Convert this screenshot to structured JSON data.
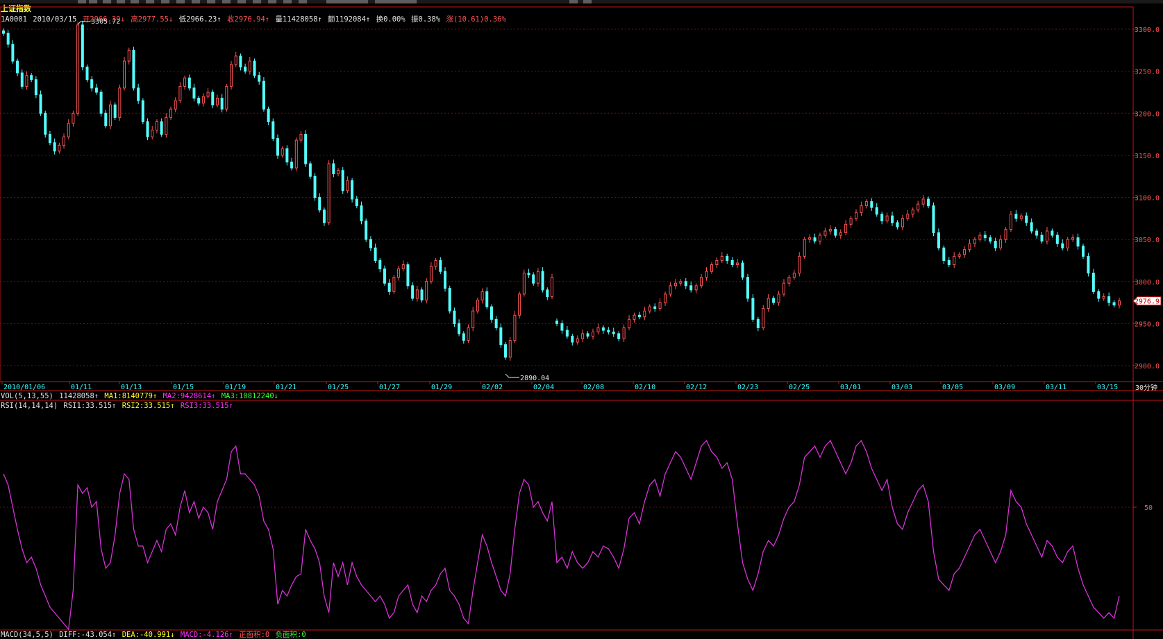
{
  "colors": {
    "background": "#000000",
    "frame": "#c81414",
    "grid": "#6e0f0f",
    "up_candle": "#ff5555",
    "down_candle": "#54ffff",
    "rsi_line": "#d633d6",
    "price_axis_text": "#ff5555",
    "date_axis_text": "#33ffff"
  },
  "header": {
    "index_name": "上证指数",
    "code": "1A0001",
    "date": "2010/03/15",
    "open_label": "开2966.39↓",
    "high_label": "高2977.55↓",
    "low_label": "低2966.23↑",
    "close_label": "收2976.94↑",
    "volume_label": "量11428058↑",
    "amount_label": "额1192084↑",
    "turnover_label": "换0.00%",
    "amplitude_label": "振0.38%",
    "change_label": "涨(10.61)0.36%"
  },
  "main_chart": {
    "price_ticks": [
      "3300.0",
      "3250.0",
      "3200.0",
      "3150.0",
      "3100.0",
      "3050.0",
      "3000.0",
      "2950.0",
      "2900.0"
    ],
    "max_label": "3305.72",
    "min_label": "2890.04",
    "current_price_label": "2976.9",
    "dates": [
      "2010/01/06",
      "01/11",
      "01/13",
      "01/15",
      "01/19",
      "01/21",
      "01/25",
      "01/27",
      "01/29",
      "02/02",
      "02/04",
      "02/08",
      "02/10",
      "02/12",
      "02/23",
      "02/25",
      "03/01",
      "03/03",
      "03/05",
      "03/09",
      "03/11",
      "03/15"
    ],
    "period_label": "30分钟"
  },
  "volume_bar": {
    "name": "VOL(5,13,55)",
    "value": "11428058↑",
    "ma1": "MA1:8140779↑",
    "ma2": "MA2:9428614↑",
    "ma3": "MA3:10812240↓"
  },
  "rsi_panel": {
    "name": "RSI(14,14,14)",
    "rsi1": "RSI1:33.515↑",
    "rsi2": "RSI2:33.515↑",
    "rsi3": "RSI3:33.515↑",
    "tick_50": "50"
  },
  "macd_bar": {
    "name": "MACD(34,5,5)",
    "diff": "DIFF:-43.054↑",
    "dea": "DEA:-40.991↓",
    "macd": "MACD:-4.126↑",
    "positive_area": "正面积:0",
    "negative_area": "负面积:0"
  },
  "chart_data": [
    {
      "type": "candlestick",
      "title": "上证指数",
      "ylim": [
        2880,
        3315
      ],
      "yticks": [
        3300,
        3250,
        3200,
        3150,
        3100,
        3050,
        3000,
        2950,
        2900
      ],
      "x_tick_labels": [
        "2010/01/06",
        "01/11",
        "01/13",
        "01/15",
        "01/19",
        "01/21",
        "01/25",
        "01/27",
        "01/29",
        "02/02",
        "02/04",
        "02/08",
        "02/10",
        "02/12",
        "02/23",
        "02/25",
        "03/01",
        "03/03",
        "03/05",
        "03/09",
        "03/11",
        "03/15"
      ],
      "close_path": [
        3295,
        3282,
        3262,
        3248,
        3232,
        3245,
        3240,
        3222,
        3200,
        3175,
        3165,
        3155,
        3162,
        3172,
        3188,
        3200,
        3305,
        3255,
        3240,
        3230,
        3225,
        3200,
        3185,
        3210,
        3195,
        3230,
        3262,
        3275,
        3230,
        3215,
        3190,
        3172,
        3180,
        3190,
        3175,
        3195,
        3205,
        3215,
        3232,
        3242,
        3230,
        3218,
        3212,
        3220,
        3225,
        3210,
        3218,
        3205,
        3232,
        3258,
        3268,
        3255,
        3250,
        3262,
        3245,
        3238,
        3205,
        3190,
        3170,
        3150,
        3158,
        3142,
        3135,
        3168,
        3175,
        3140,
        3125,
        3100,
        3085,
        3070,
        3140,
        3128,
        3132,
        3108,
        3120,
        3098,
        3090,
        3072,
        3050,
        3040,
        3025,
        3015,
        2998,
        2988,
        3005,
        3015,
        3020,
        2995,
        2980,
        2990,
        2978,
        3000,
        3018,
        3025,
        3012,
        2992,
        2965,
        2950,
        2938,
        2930,
        2945,
        2965,
        2978,
        2988,
        2970,
        2955,
        2945,
        2925,
        2910,
        2930,
        2960,
        2985,
        3010,
        3008,
        2998,
        3012,
        2990,
        2982,
        3005
      ],
      "close_path_segment_2": [
        2950,
        2942,
        2935,
        2928,
        2932,
        2938,
        2935,
        2940,
        2945,
        2942,
        2940,
        2938,
        2932,
        2945,
        2955,
        2960,
        2958,
        2965,
        2970,
        2968,
        2975,
        2985,
        2995,
        2998,
        3000,
        2995,
        2990,
        2995,
        3005,
        3012,
        3020,
        3025,
        3030,
        3025,
        3020,
        3022,
        3005,
        2980,
        2955,
        2945,
        2968,
        2980,
        2975,
        2985,
        2998,
        3005,
        3010,
        3030,
        3050,
        3052,
        3048,
        3055,
        3060,
        3062,
        3055,
        3058,
        3068,
        3075,
        3082,
        3090,
        3095,
        3088,
        3080,
        3072,
        3078,
        3070,
        3065,
        3075,
        3080,
        3085,
        3092,
        3098,
        3090,
        3058,
        3040,
        3025,
        3020,
        3030,
        3032,
        3038,
        3045,
        3050,
        3055,
        3052,
        3048,
        3040,
        3050,
        3062,
        3080,
        3075,
        3078,
        3070,
        3060,
        3055,
        3048,
        3060,
        3055,
        3045,
        3040,
        3050,
        3052,
        3042,
        3030,
        3010,
        2988,
        2980,
        2982,
        2975,
        2972,
        2976.94
      ]
    },
    {
      "type": "line",
      "title": "RSI(14,14,14)",
      "ylim": [
        0,
        100
      ],
      "yticks": [
        50
      ],
      "series": [
        {
          "name": "RSI1",
          "values": [
            62,
            58,
            50,
            42,
            35,
            30,
            32,
            28,
            22,
            18,
            14,
            12,
            10,
            8,
            6,
            20,
            58,
            55,
            57,
            50,
            52,
            35,
            28,
            30,
            40,
            55,
            62,
            60,
            42,
            36,
            36,
            30,
            34,
            38,
            34,
            42,
            44,
            40,
            50,
            56,
            48,
            52,
            46,
            50,
            48,
            42,
            52,
            56,
            60,
            70,
            72,
            62,
            62,
            60,
            58,
            54,
            45,
            42,
            35,
            15,
            20,
            18,
            22,
            25,
            26,
            42,
            38,
            35,
            30,
            18,
            12,
            30,
            25,
            30,
            22,
            30,
            25,
            22,
            20,
            18,
            16,
            18,
            15,
            10,
            12,
            18,
            20,
            22,
            15,
            12,
            18,
            16,
            20,
            22,
            26,
            28,
            20,
            18,
            15,
            10,
            8,
            20,
            30,
            40,
            36,
            30,
            25,
            20,
            18,
            26,
            42,
            55,
            60,
            58,
            50,
            52,
            48,
            45,
            52
          ],
          "values_segment_2": [
            30,
            32,
            28,
            34,
            30,
            28,
            30,
            34,
            32,
            36,
            35,
            32,
            28,
            35,
            46,
            48,
            44,
            52,
            58,
            60,
            54,
            62,
            66,
            70,
            68,
            64,
            60,
            66,
            72,
            74,
            70,
            68,
            64,
            66,
            60,
            44,
            30,
            24,
            20,
            26,
            34,
            38,
            36,
            40,
            46,
            50,
            52,
            58,
            68,
            70,
            72,
            68,
            72,
            74,
            70,
            66,
            62,
            66,
            72,
            74,
            70,
            64,
            60,
            56,
            60,
            50,
            44,
            42,
            48,
            52,
            56,
            58,
            52,
            34,
            24,
            22,
            20,
            26,
            28,
            32,
            36,
            40,
            42,
            38,
            34,
            30,
            34,
            40,
            56,
            52,
            50,
            44,
            40,
            36,
            32,
            38,
            36,
            32,
            30,
            34,
            36,
            28,
            22,
            18,
            14,
            12,
            10,
            12,
            10,
            18
          ]
        }
      ]
    }
  ]
}
